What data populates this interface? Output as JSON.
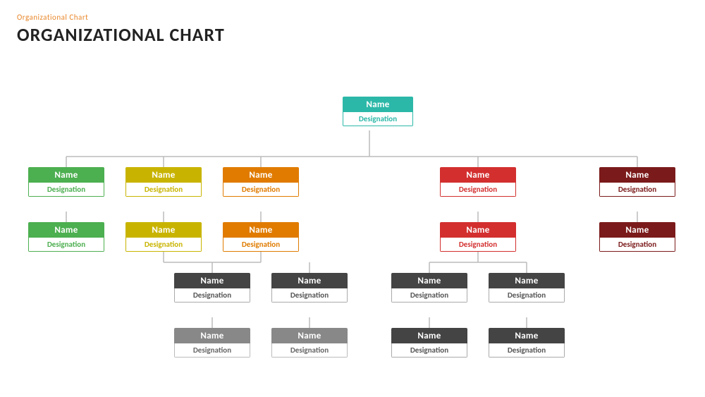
{
  "header": {
    "subtitle": "Organizational  Chart",
    "title": "ORGANIZATIONAL CHART"
  },
  "colors": {
    "teal": "#2cb8a8",
    "green": "#4caf50",
    "olive": "#c8b400",
    "orange": "#e07b00",
    "red": "#d32f2f",
    "darkred": "#7b1a1a",
    "darkgray": "#444444",
    "lightgray": "#888888"
  },
  "nodes": {
    "root": {
      "name": "Name",
      "designation": "Designation"
    },
    "l1_1": {
      "name": "Name",
      "designation": "Designation"
    },
    "l1_2": {
      "name": "Name",
      "designation": "Designation"
    },
    "l1_3": {
      "name": "Name",
      "designation": "Designation"
    },
    "l1_4": {
      "name": "Name",
      "designation": "Designation"
    },
    "l1_5": {
      "name": "Name",
      "designation": "Designation"
    },
    "l2_1": {
      "name": "Name",
      "designation": "Designation"
    },
    "l2_2": {
      "name": "Name",
      "designation": "Designation"
    },
    "l2_3": {
      "name": "Name",
      "designation": "Designation"
    },
    "l2_4": {
      "name": "Name",
      "designation": "Designation"
    },
    "l2_5": {
      "name": "Name",
      "designation": "Designation"
    },
    "l3_1": {
      "name": "Name",
      "designation": "Designation"
    },
    "l3_2": {
      "name": "Name",
      "designation": "Designation"
    },
    "l3_3": {
      "name": "Name",
      "designation": "Designation"
    },
    "l3_4": {
      "name": "Name",
      "designation": "Designation"
    },
    "l4_1": {
      "name": "Name",
      "designation": "Designation"
    },
    "l4_2": {
      "name": "Name",
      "designation": "Designation"
    },
    "l4_3": {
      "name": "Name",
      "designation": "Designation"
    },
    "l4_4": {
      "name": "Name",
      "designation": "Designation"
    }
  }
}
